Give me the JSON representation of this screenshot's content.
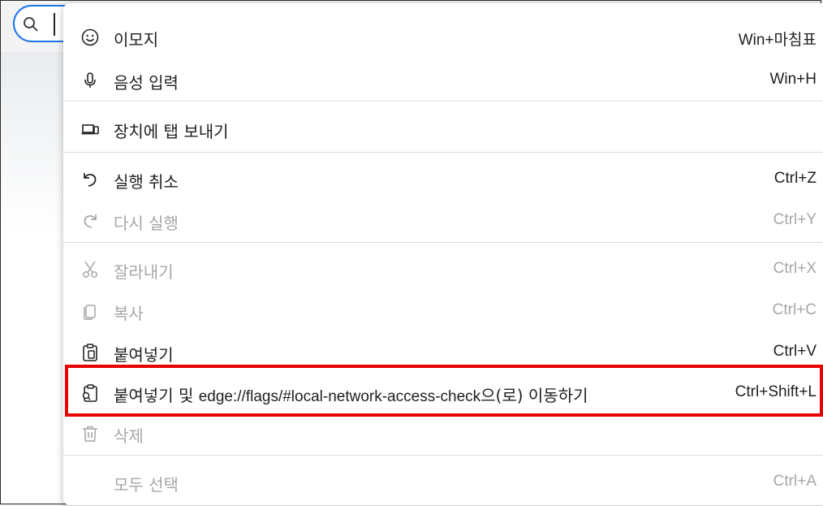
{
  "menu": {
    "items": [
      {
        "label": "이모지",
        "shortcut": "Win+마침표",
        "icon": "emoji-icon",
        "enabled": true
      },
      {
        "label": "음성 입력",
        "shortcut": "Win+H",
        "icon": "microphone-icon",
        "enabled": true
      },
      {
        "label": "장치에 탭 보내기",
        "shortcut": "",
        "icon": "send-to-device-icon",
        "enabled": true
      },
      {
        "label": "실행 취소",
        "shortcut": "Ctrl+Z",
        "icon": "undo-icon",
        "enabled": true
      },
      {
        "label": "다시 실행",
        "shortcut": "Ctrl+Y",
        "icon": "redo-icon",
        "enabled": false
      },
      {
        "label": "잘라내기",
        "shortcut": "Ctrl+X",
        "icon": "cut-icon",
        "enabled": false
      },
      {
        "label": "복사",
        "shortcut": "Ctrl+C",
        "icon": "copy-icon",
        "enabled": false
      },
      {
        "label": "붙여넣기",
        "shortcut": "Ctrl+V",
        "icon": "paste-icon",
        "enabled": true
      },
      {
        "label_prefix": "붙여넣기 및 ",
        "label_url": "edge://flags/#local-network-access-check",
        "label_suffix": "으(로) 이동하기",
        "shortcut": "Ctrl+Shift+L",
        "icon": "paste-and-go-icon",
        "enabled": true
      },
      {
        "label": "삭제",
        "shortcut": "",
        "icon": "trash-icon",
        "enabled": false
      },
      {
        "label": "모두 선택",
        "shortcut": "Ctrl+A",
        "icon": "",
        "enabled": false
      }
    ]
  },
  "colors": {
    "highlight_border": "#e60000",
    "focus_ring": "#1a73e8",
    "disabled_text": "#a6a6a6"
  }
}
